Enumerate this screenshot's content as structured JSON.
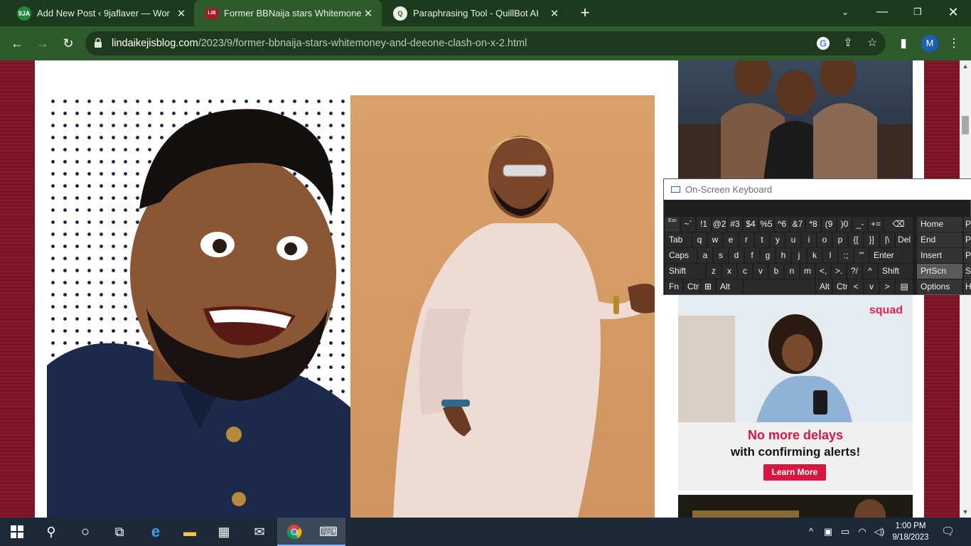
{
  "browser": {
    "tabs": [
      {
        "favicon": "9JA",
        "title": "Add New Post ‹ 9jaflaver — Wor",
        "active": false
      },
      {
        "favicon": "LIB",
        "title": "Former BBNaija stars Whitemone",
        "active": true
      },
      {
        "favicon": "Q",
        "title": "Paraphrasing Tool - QuillBot AI",
        "active": false
      }
    ],
    "new_tab_label": "+",
    "url_host": "lindaikejisblog.com",
    "url_path": "/2023/9/former-bbnaija-stars-whitemoney-and-deeone-clash-on-x-2.html",
    "profile_initial": "M"
  },
  "ads": {
    "squad": {
      "logo": "squad",
      "headline1": "No more delays",
      "headline2": "with confirming alerts!",
      "button": "Learn More"
    }
  },
  "osk": {
    "title": "On-Screen Keyboard",
    "rows": [
      [
        "Esc",
        "~`",
        "!1",
        "@2",
        "#3",
        "$4",
        "%5",
        "^6",
        "&7",
        "*8",
        "(9",
        ")0",
        "_-",
        "+=",
        "⌫"
      ],
      [
        "Tab",
        "q",
        "w",
        "e",
        "r",
        "t",
        "y",
        "u",
        "i",
        "o",
        "p",
        "{[",
        "}]",
        "|\\",
        "Del"
      ],
      [
        "Caps",
        "a",
        "s",
        "d",
        "f",
        "g",
        "h",
        "j",
        "k",
        "l",
        ":;",
        "\"'",
        "Enter"
      ],
      [
        "Shift",
        "z",
        "x",
        "c",
        "v",
        "b",
        "n",
        "m",
        "<,",
        ">.",
        "?/",
        "^",
        "Shift"
      ],
      [
        "Fn",
        "Ctrl",
        "⊞",
        "Alt",
        "",
        "Alt",
        "Ctrl",
        "<",
        "v",
        ">",
        "▤"
      ]
    ],
    "side_keys": [
      "Home",
      "End",
      "Insert",
      "PrtScn",
      "Options"
    ],
    "side_keys_2": [
      "P",
      "P",
      "P",
      "S",
      "H"
    ]
  },
  "taskbar": {
    "time": "1:00 PM",
    "date": "9/18/2023"
  },
  "colors": {
    "frame_green": "#2f5a2b",
    "tabstrip_green": "#1c3a1c",
    "page_maroon": "#7b1322",
    "squad_red": "#d8173f",
    "taskbar": "#1c2a38"
  }
}
